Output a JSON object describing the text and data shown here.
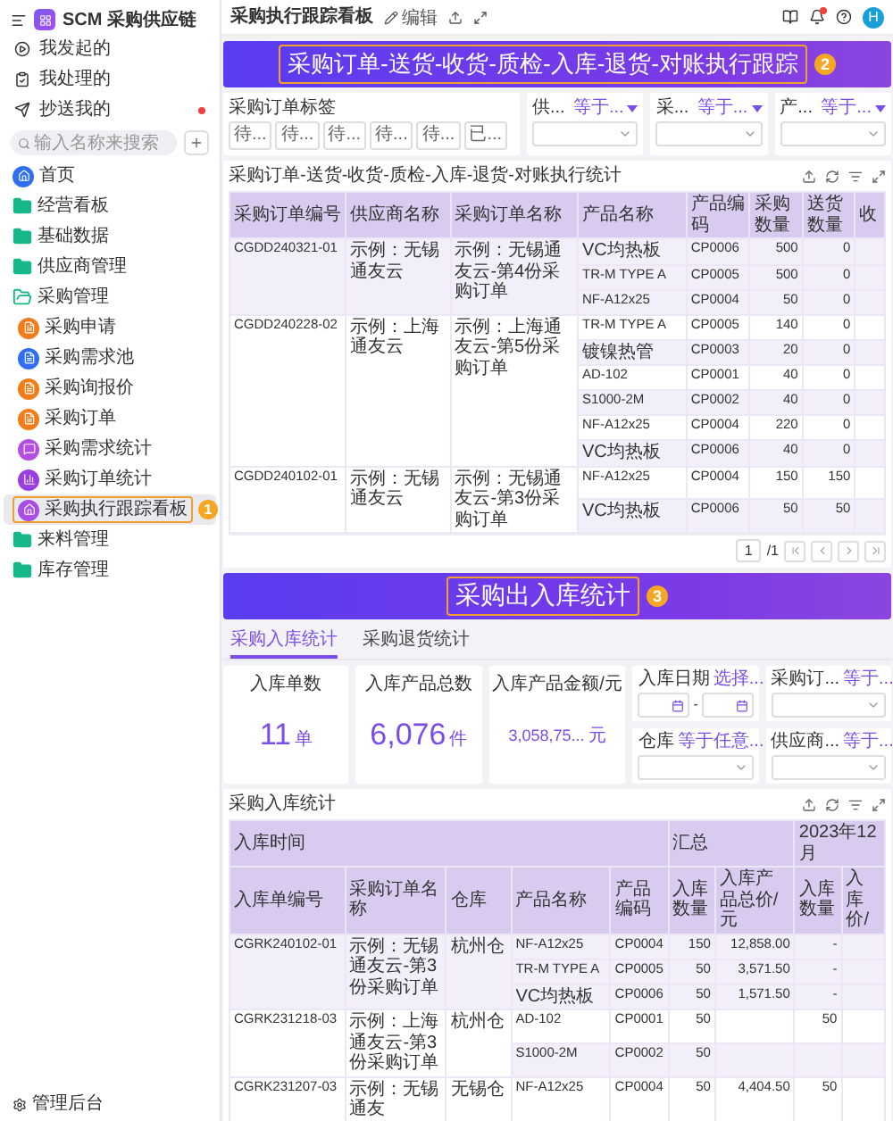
{
  "sidebar": {
    "app_title": "SCM 采购供应链",
    "quick": [
      {
        "label": "我发起的",
        "kind": "play",
        "dot": false
      },
      {
        "label": "我处理的",
        "kind": "check",
        "dot": false
      },
      {
        "label": "抄送我的",
        "kind": "send",
        "dot": true
      }
    ],
    "search": {
      "placeholder": "输入名称来搜索"
    },
    "nav": [
      {
        "label": "首页",
        "kind": "home"
      },
      {
        "label": "经营看板",
        "kind": "folder",
        "expanded": false
      },
      {
        "label": "基础数据",
        "kind": "folder",
        "expanded": false
      },
      {
        "label": "供应商管理",
        "kind": "folder",
        "expanded": false
      },
      {
        "label": "采购管理",
        "kind": "folder",
        "expanded": true,
        "children": [
          {
            "label": "采购申请",
            "color": "#f07c1a",
            "kind": "doc",
            "selected": false
          },
          {
            "label": "采购需求池",
            "color": "#2f6ff0",
            "kind": "doc",
            "selected": false
          },
          {
            "label": "采购询报价",
            "color": "#f07c1a",
            "kind": "doc",
            "selected": false
          },
          {
            "label": "采购订单",
            "color": "#f07c1a",
            "kind": "doc",
            "selected": false
          },
          {
            "label": "采购需求统计",
            "color": "#b34ee0",
            "kind": "chat",
            "selected": false
          },
          {
            "label": "采购订单统计",
            "color": "#9b3fe0",
            "kind": "chart",
            "selected": false
          },
          {
            "label": "采购执行跟踪看板",
            "color": "#a64ee6",
            "kind": "home",
            "selected": true,
            "badge": "1"
          }
        ]
      },
      {
        "label": "来料管理",
        "kind": "folder",
        "expanded": false
      },
      {
        "label": "库存管理",
        "kind": "folder",
        "expanded": false
      }
    ],
    "footer": "管理后台"
  },
  "topbar": {
    "title": "采购执行跟踪看板",
    "edit": "编辑",
    "avatar": "H",
    "bell_dot": true
  },
  "banner_1": {
    "title": "采购订单-送货-收货-质检-入库-退货-对账执行跟踪",
    "badge": "2"
  },
  "tag_filter": {
    "label": "采购订单标签",
    "chips": [
      "待...",
      "待...",
      "待...",
      "待...",
      "待...",
      "已..."
    ]
  },
  "filters_1": [
    {
      "label": "供...",
      "operator": "等于..."
    },
    {
      "label": "采...",
      "operator": "等于..."
    },
    {
      "label": "产...",
      "operator": "等于..."
    }
  ],
  "table_1": {
    "title": "采购订单-送货-收货-质检-入库-退货-对账执行统计",
    "columns": [
      "采购订单编号",
      "供应商名称",
      "采购订单名称",
      "产品名称",
      "产品编码",
      "采购数量",
      "送货数量",
      "收"
    ],
    "orders": [
      {
        "code": "CGDD240321-01",
        "supplier": "示例：无锡通友云",
        "name": "示例：无锡通友云-第4份采购订单",
        "items": [
          {
            "product": "VC均热板",
            "code": "CP0006",
            "qty": "500",
            "delivered": "0"
          },
          {
            "product": "TR-M TYPE A",
            "code": "CP0005",
            "qty": "500",
            "delivered": "0"
          },
          {
            "product": "NF-A12x25",
            "code": "CP0004",
            "qty": "50",
            "delivered": "0"
          }
        ]
      },
      {
        "code": "CGDD240228-02",
        "supplier": "示例：上海通友云",
        "name": "示例：上海通友云-第5份采购订单",
        "items": [
          {
            "product": "TR-M TYPE A",
            "code": "CP0005",
            "qty": "140",
            "delivered": "0"
          },
          {
            "product": "镀镍热管",
            "code": "CP0003",
            "qty": "20",
            "delivered": "0"
          },
          {
            "product": "AD-102",
            "code": "CP0001",
            "qty": "40",
            "delivered": "0"
          },
          {
            "product": "S1000-2M",
            "code": "CP0002",
            "qty": "40",
            "delivered": "0"
          },
          {
            "product": "NF-A12x25",
            "code": "CP0004",
            "qty": "220",
            "delivered": "0"
          },
          {
            "product": "VC均热板",
            "code": "CP0006",
            "qty": "40",
            "delivered": "0"
          }
        ]
      },
      {
        "code": "CGDD240102-01",
        "supplier": "示例：无锡通友云",
        "name": "示例：无锡通友云-第3份采购订单",
        "items": [
          {
            "product": "NF-A12x25",
            "code": "CP0004",
            "qty": "150",
            "delivered": "150"
          },
          {
            "product": "VC均热板",
            "code": "CP0006",
            "qty": "50",
            "delivered": "50"
          }
        ]
      }
    ],
    "page": "1",
    "pages": "/1"
  },
  "banner_2": {
    "title": "采购出入库统计",
    "badge": "3"
  },
  "tabs": [
    {
      "label": "采购入库统计",
      "selected": true
    },
    {
      "label": "采购退货统计",
      "selected": false
    }
  ],
  "stats": [
    {
      "label": "入库单数",
      "value": "11",
      "unit": "单",
      "kind": "big"
    },
    {
      "label": "入库产品总数",
      "value": "6,076",
      "unit": "件",
      "kind": "big"
    },
    {
      "label": "入库产品金额/元",
      "value": "3,058,75...",
      "unit": "元",
      "kind": "small"
    }
  ],
  "filters_2": [
    {
      "label": "入库日期",
      "operator": "选择...",
      "kind": "date-range",
      "separator": "-"
    },
    {
      "label": "采购订...",
      "operator": "等于...",
      "kind": "select"
    },
    {
      "label": "仓库",
      "operator": "等于任意...",
      "kind": "select"
    },
    {
      "label": "供应商...",
      "operator": "等于...",
      "kind": "select"
    }
  ],
  "table_2": {
    "title": "采购入库统计",
    "column_groups": [
      {
        "label": "入库时间",
        "columns": [
          "入库单编号",
          "采购订单名称",
          "仓库",
          "产品名称",
          "产品编码"
        ]
      },
      {
        "label": "汇总",
        "columns": [
          "入库数量",
          "入库产品总价/元"
        ]
      },
      {
        "label": "2023年12月",
        "columns": [
          "入库数量",
          "入库价/"
        ]
      }
    ],
    "receipts": [
      {
        "code": "CGRK240102-01",
        "order_name": "示例：无锡通友云-第3份采购订单",
        "warehouse": "杭州仓",
        "items": [
          {
            "product": "NF-A12x25",
            "code": "CP0004",
            "qty": "150",
            "total": "12,858.00",
            "month_qty": "-"
          },
          {
            "product": "TR-M TYPE A",
            "code": "CP0005",
            "qty": "50",
            "total": "3,571.50",
            "month_qty": "-"
          },
          {
            "product": "VC均热板",
            "code": "CP0006",
            "qty": "50",
            "total": "1,571.50",
            "month_qty": "-"
          }
        ]
      },
      {
        "code": "CGRK231218-03",
        "order_name": "示例：上海通友云-第3份采购订单",
        "warehouse": "杭州仓",
        "items": [
          {
            "product": "AD-102",
            "code": "CP0001",
            "qty": "50",
            "month_qty": "50"
          },
          {
            "product": "S1000-2M",
            "code": "CP0002",
            "qty": "50"
          }
        ]
      },
      {
        "code": "CGRK231207-03",
        "order_name": "示例：无锡通友",
        "warehouse": "无锡仓",
        "items": [
          {
            "product": "NF-A12x25",
            "code": "CP0004",
            "qty": "50",
            "total": "4,404.50",
            "month_qty": "50"
          }
        ]
      }
    ]
  }
}
